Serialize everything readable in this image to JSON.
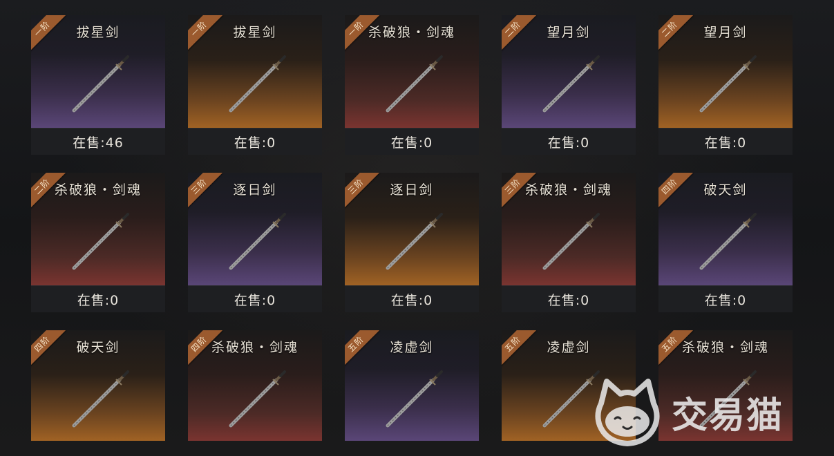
{
  "items": [
    {
      "name": "拔星剑",
      "tier": "一阶",
      "on_sale": "在售:46",
      "bg": "purple"
    },
    {
      "name": "拔星剑",
      "tier": "一阶",
      "on_sale": "在售:0",
      "bg": "orange"
    },
    {
      "name": "杀破狼・剑魂",
      "tier": "一阶",
      "on_sale": "在售:0",
      "bg": "red"
    },
    {
      "name": "望月剑",
      "tier": "二阶",
      "on_sale": "在售:0",
      "bg": "purple"
    },
    {
      "name": "望月剑",
      "tier": "二阶",
      "on_sale": "在售:0",
      "bg": "orange"
    },
    {
      "name": "杀破狼・剑魂",
      "tier": "二阶",
      "on_sale": "在售:0",
      "bg": "red"
    },
    {
      "name": "逐日剑",
      "tier": "三阶",
      "on_sale": "在售:0",
      "bg": "purple"
    },
    {
      "name": "逐日剑",
      "tier": "三阶",
      "on_sale": "在售:0",
      "bg": "orange"
    },
    {
      "name": "杀破狼・剑魂",
      "tier": "三阶",
      "on_sale": "在售:0",
      "bg": "red"
    },
    {
      "name": "破天剑",
      "tier": "四阶",
      "on_sale": "在售:0",
      "bg": "purple"
    },
    {
      "name": "破天剑",
      "tier": "四阶",
      "on_sale": "",
      "bg": "orange"
    },
    {
      "name": "杀破狼・剑魂",
      "tier": "四阶",
      "on_sale": "",
      "bg": "red"
    },
    {
      "name": "凌虚剑",
      "tier": "五阶",
      "on_sale": "",
      "bg": "purple"
    },
    {
      "name": "凌虚剑",
      "tier": "五阶",
      "on_sale": "",
      "bg": "orange"
    },
    {
      "name": "杀破狼・剑魂",
      "tier": "五阶",
      "on_sale": "",
      "bg": "red"
    }
  ],
  "watermark": {
    "text": "交易猫",
    "icon": "cat-face-icon"
  },
  "colors": {
    "ribbon": "#9b5a2e",
    "footer": "#1e1f22",
    "text": "#e8e4dc"
  }
}
